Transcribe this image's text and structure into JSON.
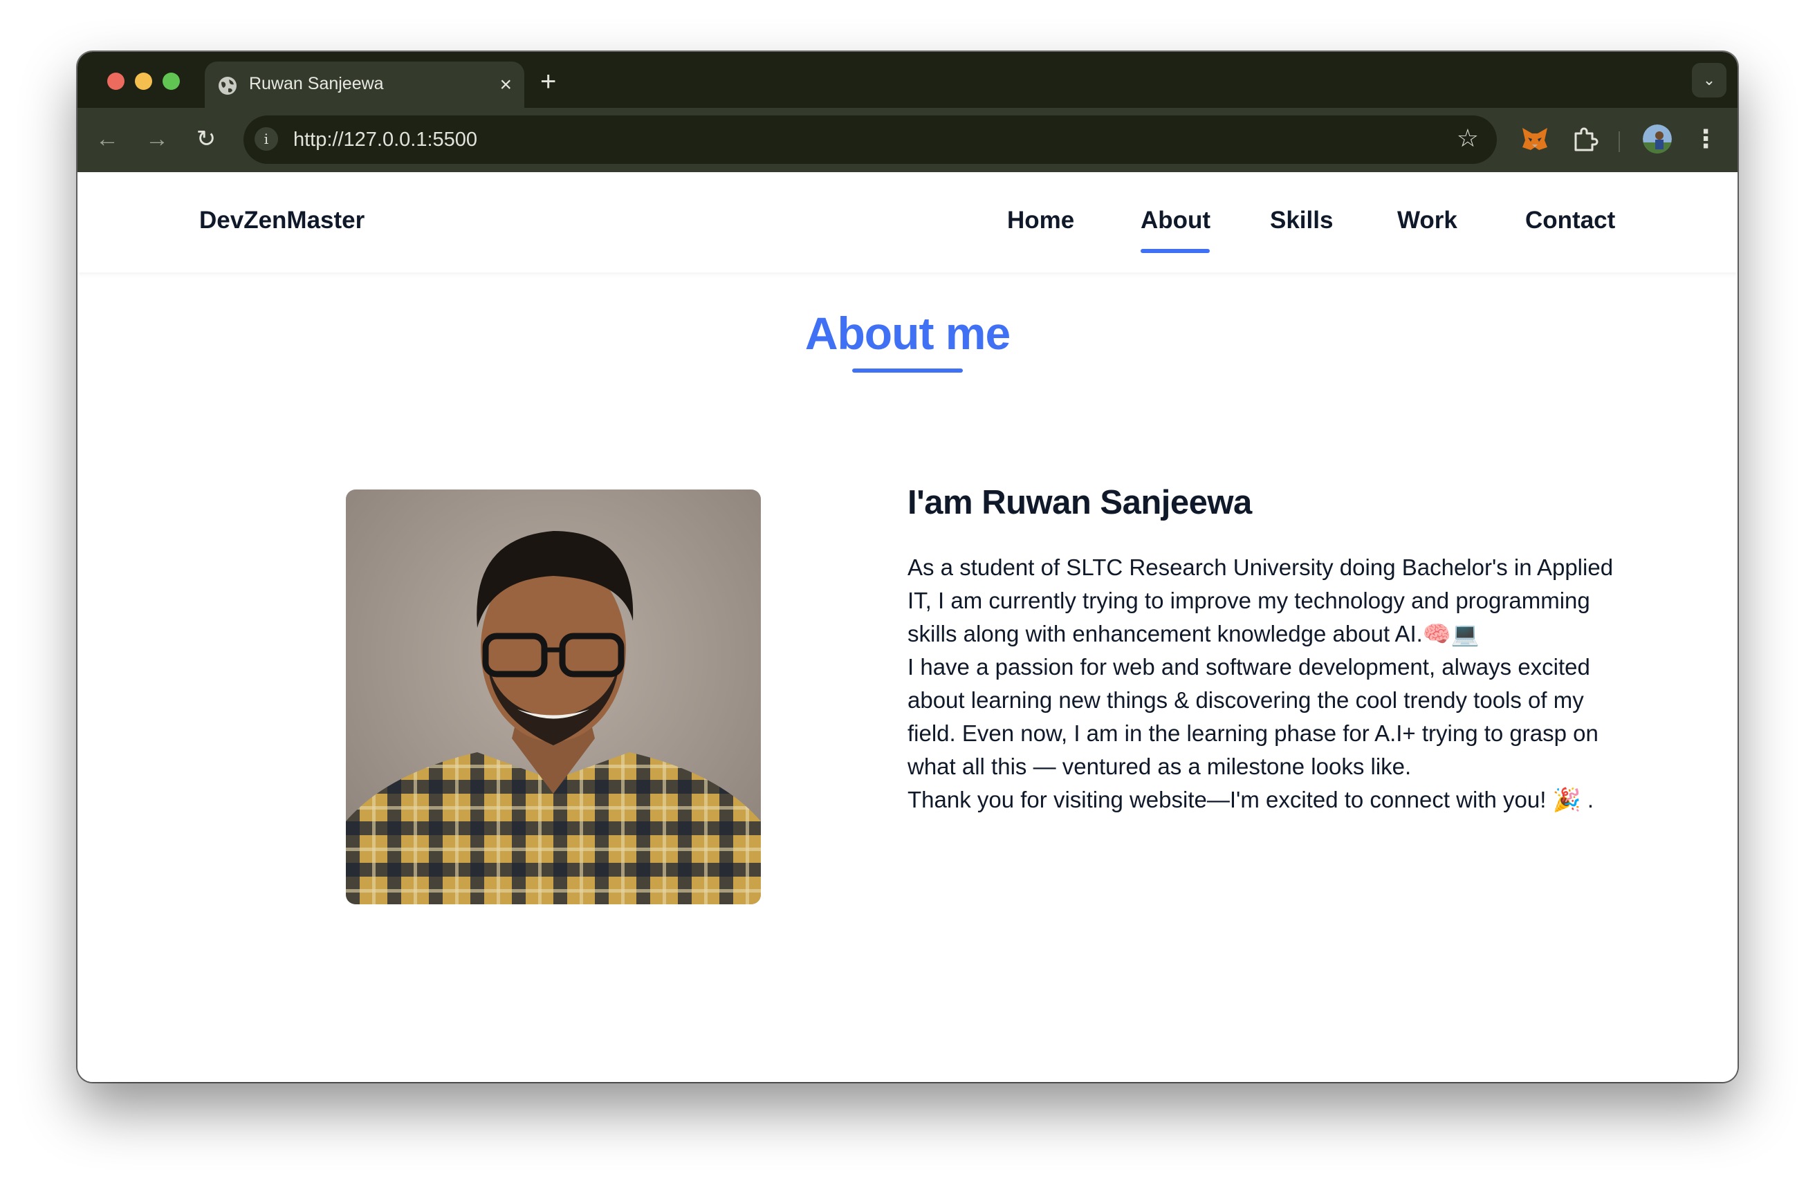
{
  "browser": {
    "tab_title": "Ruwan Sanjeewa",
    "tab_close": "×",
    "new_tab": "+",
    "tab_menu": "⌄",
    "url": "http://127.0.0.1:5500",
    "site_info": "i",
    "back": "←",
    "forward": "→",
    "reload": "↻",
    "bookmark": "☆",
    "menu": "⋮"
  },
  "site": {
    "logo": "DevZenMaster",
    "nav": [
      "Home",
      "About",
      "Skills",
      "Work",
      "Contact"
    ],
    "active_nav": "About",
    "accent_color": "#4070f4",
    "text_color": "#0f1929"
  },
  "about": {
    "title": "About me",
    "greeting": "I'am Ruwan Sanjeewa",
    "paragraphs": [
      "As a student of SLTC Research University doing Bachelor's in Applied IT, I am currently trying to improve my technology and programming skills along with enhancement knowledge about AI.🧠💻",
      "I have a passion for web and software development, always excited about learning new things & discovering the cool trendy tools of my field. Even now, I am in the learning phase for A.I+ trying to grasp on what all this — ventured as a milestone looks like.",
      "Thank you for visiting website—I'm excited to connect with you! 🎉 ."
    ]
  }
}
